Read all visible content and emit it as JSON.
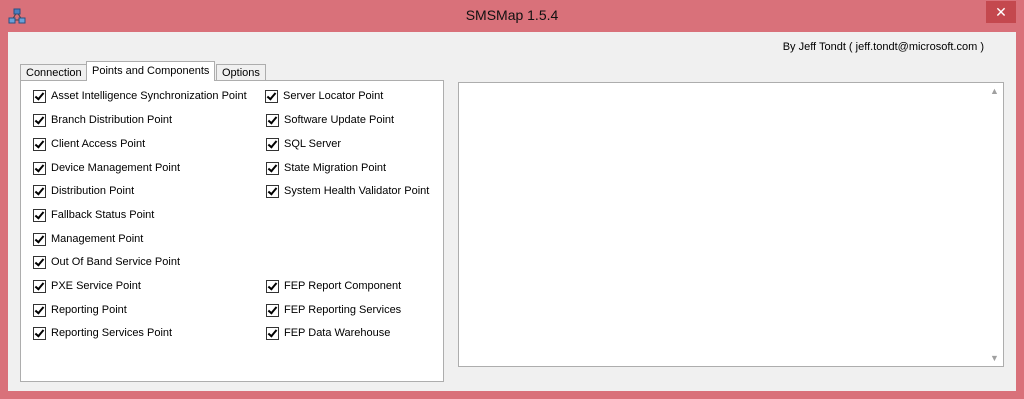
{
  "window": {
    "title": "SMSMap 1.5.4",
    "close_glyph": "✕",
    "author": "By Jeff Tondt ( jeff.tondt@microsoft.com )"
  },
  "tabs": [
    {
      "label": "Connection",
      "active": false
    },
    {
      "label": "Points and Components",
      "active": true
    },
    {
      "label": "Options",
      "active": false
    }
  ],
  "left_items": [
    {
      "label": "Asset Intelligence Synchronization Point",
      "checked": true
    },
    {
      "label": "Branch Distribution Point",
      "checked": true
    },
    {
      "label": "Client Access Point",
      "checked": true
    },
    {
      "label": "Device Management Point",
      "checked": true
    },
    {
      "label": "Distribution Point",
      "checked": true
    },
    {
      "label": "Fallback Status Point",
      "checked": true
    },
    {
      "label": "Management Point",
      "checked": true
    },
    {
      "label": "Out Of Band Service Point",
      "checked": true
    },
    {
      "label": "PXE Service Point",
      "checked": true
    },
    {
      "label": "Reporting Point",
      "checked": true
    },
    {
      "label": "Reporting Services Point",
      "checked": true
    }
  ],
  "right_items": [
    {
      "label": "Server Locator Point",
      "checked": true
    },
    {
      "label": "Software Update Point",
      "checked": true
    },
    {
      "label": "SQL Server",
      "checked": true
    },
    {
      "label": "State Migration Point",
      "checked": true
    },
    {
      "label": "System Health Validator Point",
      "checked": true
    }
  ],
  "fep_items": [
    {
      "label": "FEP Report Component",
      "checked": true
    },
    {
      "label": "FEP Reporting Services",
      "checked": true
    },
    {
      "label": "FEP Data Warehouse",
      "checked": true
    }
  ],
  "colors": {
    "frame": "#d9717a",
    "close": "#c4484e",
    "client": "#f0f0f0"
  },
  "icons": {
    "app": "network-icon",
    "close": "close-icon",
    "scroll_up": "chevron-up-icon",
    "scroll_down": "chevron-down-icon"
  }
}
